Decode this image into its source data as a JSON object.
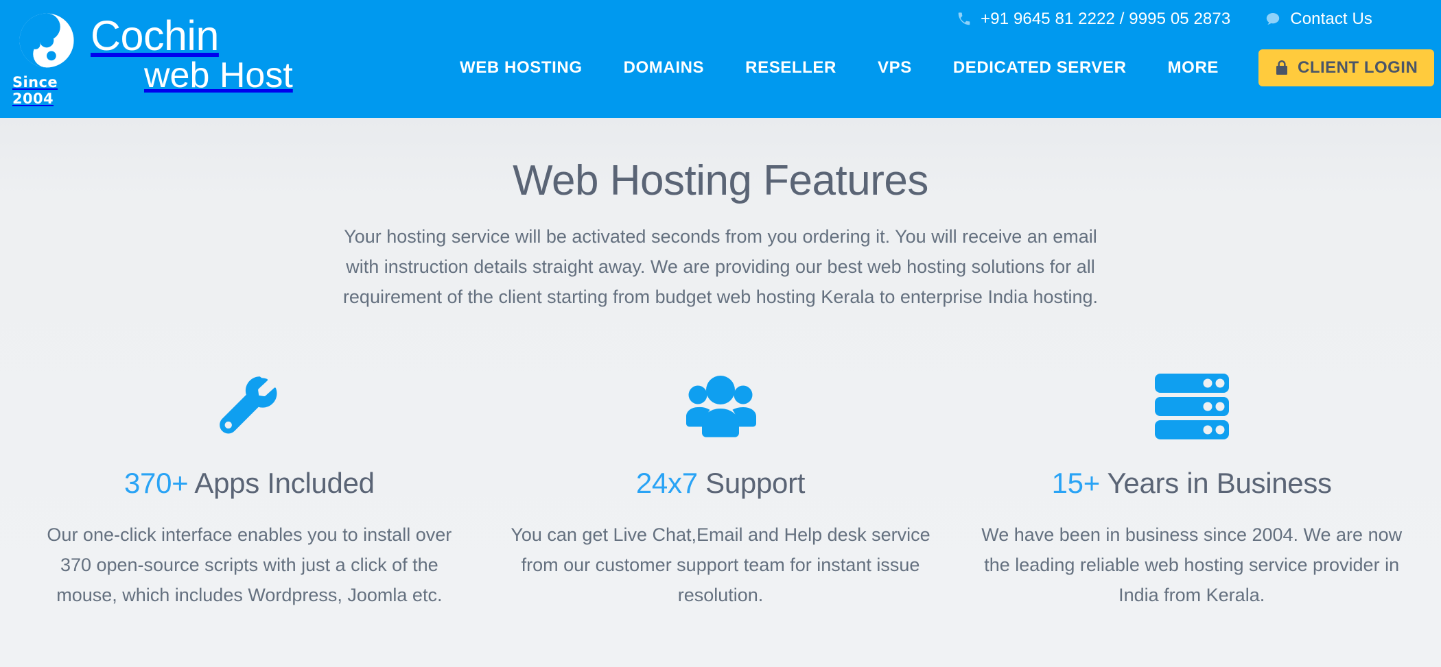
{
  "colors": {
    "brand_blue": "#0099ef",
    "accent_blue": "#29a3f5",
    "cta_yellow": "#ffcb3d",
    "cta_text": "#4a5568",
    "page_bg": "#eceef0",
    "heading_text": "#5a6475",
    "body_text": "#64707f"
  },
  "header": {
    "logo": {
      "line1": "Cochin",
      "line2": "web Host",
      "since": "Since 2004",
      "mark_icon": "cochin-circle-logo-icon"
    },
    "topbar": {
      "phone_icon": "phone-icon",
      "phone": "+91 9645 81 2222 / 9995 05 2873",
      "contact_icon": "chat-bubble-icon",
      "contact_label": "Contact Us"
    },
    "nav": {
      "items": [
        {
          "label": "WEB HOSTING"
        },
        {
          "label": "DOMAINS"
        },
        {
          "label": "RESELLER"
        },
        {
          "label": "VPS"
        },
        {
          "label": "DEDICATED SERVER"
        },
        {
          "label": "MORE"
        }
      ],
      "client_login": {
        "label": "CLIENT LOGIN",
        "icon": "lock-icon"
      }
    }
  },
  "main": {
    "title": "Web Hosting Features",
    "intro": "Your hosting service will be activated seconds from you ordering it. You will receive an email with instruction details straight away. We are providing our best web hosting solutions for all requirement of the client starting from budget web hosting Kerala to enterprise India hosting.",
    "features": [
      {
        "icon": "wrench-icon",
        "highlight": "370+",
        "title": " Apps Included",
        "desc": "Our one-click interface enables you to install over 370 open-source scripts with just a click of the mouse, which includes Wordpress, Joomla etc."
      },
      {
        "icon": "users-group-icon",
        "highlight": "24x7",
        "title": " Support",
        "desc": "You can get Live Chat,Email and Help desk service from our customer support team for instant issue resolution."
      },
      {
        "icon": "server-stack-icon",
        "highlight": "15+",
        "title": " Years in Business",
        "desc": "We have been in business since 2004. We are now the leading reliable web hosting service provider in India from Kerala."
      }
    ]
  }
}
